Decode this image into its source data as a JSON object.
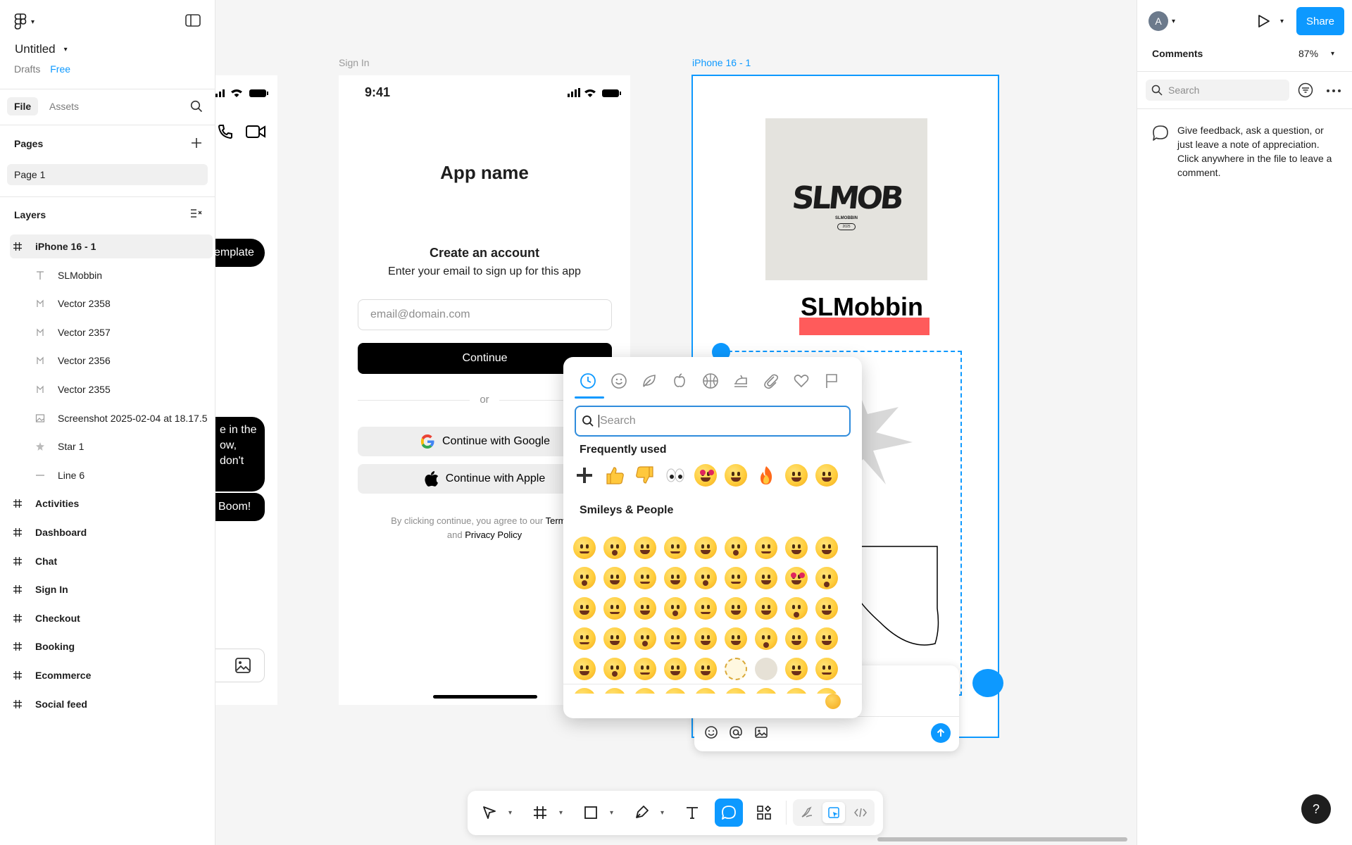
{
  "app": {
    "file_title": "Untitled",
    "location": "Drafts",
    "plan_badge": "Free"
  },
  "left_panel": {
    "tabs": [
      "File",
      "Assets"
    ],
    "pages_header": "Pages",
    "pages": [
      "Page 1"
    ],
    "layers_header": "Layers",
    "layers": [
      {
        "name": "iPhone 16 - 1",
        "type": "frame"
      },
      {
        "name": "SLMobbin",
        "type": "text"
      },
      {
        "name": "Vector 2358",
        "type": "vector"
      },
      {
        "name": "Vector 2357",
        "type": "vector"
      },
      {
        "name": "Vector 2356",
        "type": "vector"
      },
      {
        "name": "Vector 2355",
        "type": "vector"
      },
      {
        "name": "Screenshot 2025-02-04 at 18.17.5",
        "type": "image"
      },
      {
        "name": "Star 1",
        "type": "star"
      },
      {
        "name": "Line 6",
        "type": "line"
      },
      {
        "name": "Activities",
        "type": "frame"
      },
      {
        "name": "Dashboard",
        "type": "frame"
      },
      {
        "name": "Chat",
        "type": "frame"
      },
      {
        "name": "Sign In",
        "type": "frame"
      },
      {
        "name": "Checkout",
        "type": "frame"
      },
      {
        "name": "Booking",
        "type": "frame"
      },
      {
        "name": "Ecommerce",
        "type": "frame"
      },
      {
        "name": "Social feed",
        "type": "frame"
      }
    ]
  },
  "canvas": {
    "chat_frame": {
      "template_button": "emplate",
      "bubble_text": "e in the\now,\ndon't",
      "boom_text": "Boom!"
    },
    "sign_in": {
      "frame_label": "Sign In",
      "time": "9:41",
      "app_name": "App name",
      "heading": "Create an account",
      "subheading": "Enter your email to sign up for this app",
      "email_placeholder": "email@domain.com",
      "continue_label": "Continue",
      "divider": "or",
      "google_label": "Continue with Google",
      "apple_label": "Continue with Apple",
      "terms_prefix": "By clicking continue, you agree to our ",
      "terms_link": "Terms o",
      "terms_and": "and ",
      "privacy_link": "Privacy Policy"
    },
    "iphone16": {
      "frame_label": "iPhone 16 - 1",
      "logo_text": "SLMOB",
      "logo_subtext": "SLMOBBIN",
      "logo_year": "2025",
      "title": "SLMobbin"
    }
  },
  "emoji_picker": {
    "search_placeholder": "Search",
    "categories": [
      "recent-icon",
      "smileys-icon",
      "nature-icon",
      "food-icon",
      "activity-icon",
      "travel-icon",
      "objects-icon",
      "symbols-icon",
      "flags-icon"
    ],
    "frequently_used_header": "Frequently used",
    "frequently_used": [
      "plus",
      "thumbs-up",
      "thumbs-down",
      "eyes",
      "heart-eyes",
      "tears-of-joy",
      "fire",
      "grin",
      "sweat-smile"
    ],
    "smileys_header": "Smileys & People",
    "smileys_rows": 6,
    "smileys_cols": 9
  },
  "comment_composer": {
    "icons": [
      "emoji-icon",
      "mention-icon",
      "attach-image-icon",
      "send-icon"
    ]
  },
  "toolbar": {
    "tools": [
      "move-tool",
      "frame-tool",
      "shape-tool",
      "pen-tool",
      "text-tool",
      "comment-tool",
      "actions-tool"
    ],
    "modes": [
      "draw-mode",
      "design-mode",
      "dev-mode"
    ]
  },
  "right_panel": {
    "avatar_initial": "A",
    "share_label": "Share",
    "tab_label": "Comments",
    "zoom": "87%",
    "search_placeholder": "Search",
    "empty_message": "Give feedback, ask a question, or just leave a note of appreciation. Click anywhere in the file to leave a comment.",
    "help_label": "?"
  },
  "colors": {
    "accent": "#0d99ff",
    "highlight_red": "#ff5b5b",
    "logo_bg": "#e4e3de"
  }
}
